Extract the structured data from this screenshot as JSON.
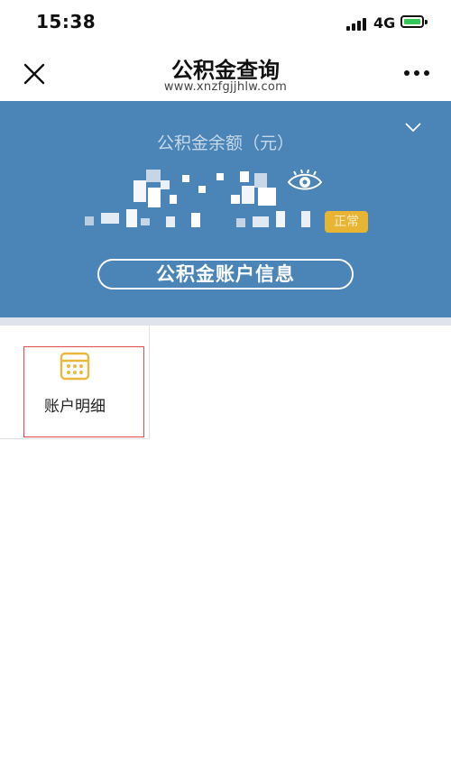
{
  "status_bar": {
    "time": "15:38",
    "network": "4G"
  },
  "header": {
    "title": "公积金查询",
    "subtitle": "www.xnzfgjjhlw.com"
  },
  "card": {
    "balance_label": "公积金余额（元）",
    "status_badge": "正常",
    "info_button": "公积金账户信息"
  },
  "menu": {
    "items": [
      {
        "label": "账户明细",
        "icon": "calculator-icon"
      }
    ]
  },
  "colors": {
    "card_bg": "#4b84b6",
    "badge_bg": "#e7b533",
    "highlight": "#e34b4b",
    "icon": "#e9b93d"
  }
}
